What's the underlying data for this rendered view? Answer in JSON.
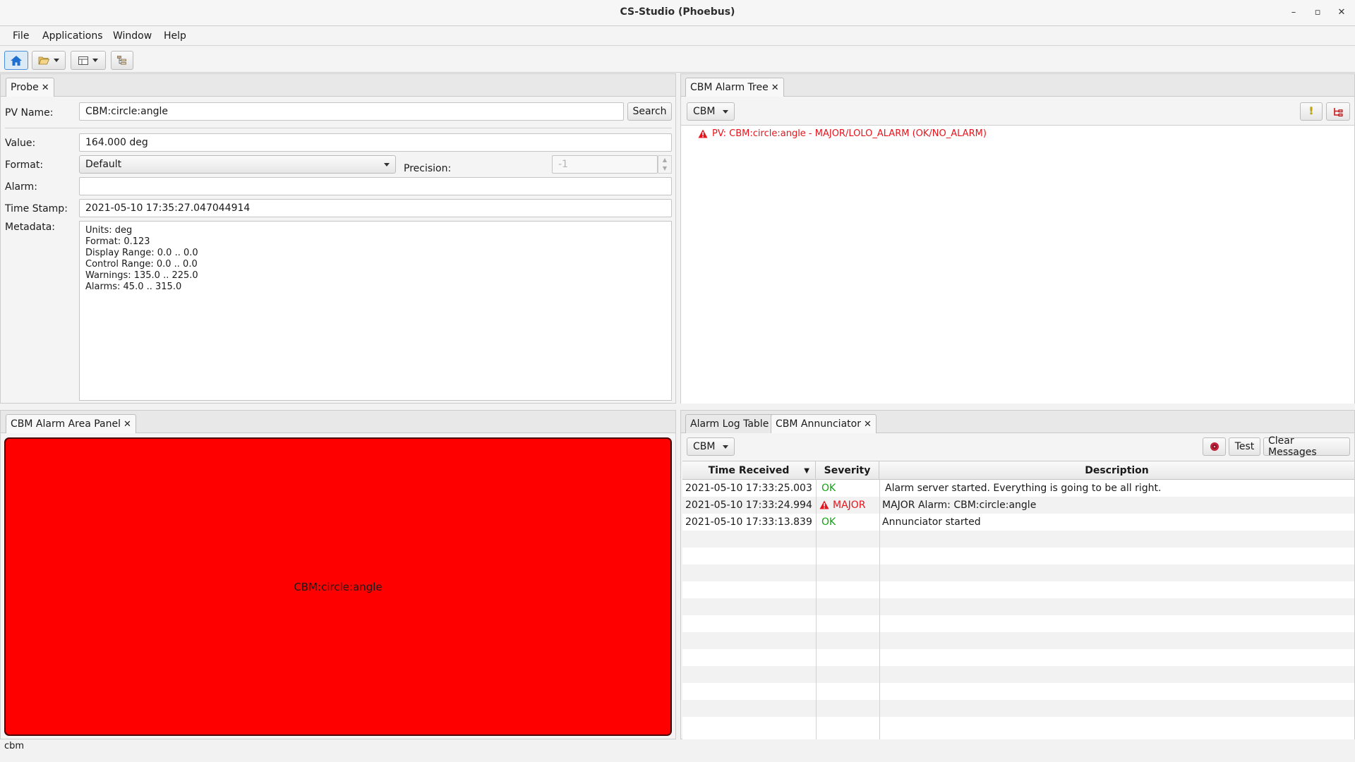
{
  "window": {
    "title": "CS-Studio (Phoebus)",
    "minimize": "–",
    "maximize": "▫",
    "close": "✕"
  },
  "menu": [
    "File",
    "Applications",
    "Window",
    "Help"
  ],
  "probe": {
    "tab_label": "Probe",
    "pv_name_label": "PV Name:",
    "pv_name_value": "CBM:circle:angle",
    "search_label": "Search",
    "value_label": "Value:",
    "value": "164.000 deg",
    "format_label": "Format:",
    "format_value": "Default",
    "precision_label": "Precision:",
    "precision_value": "-1",
    "alarm_label": "Alarm:",
    "alarm_value": "",
    "timestamp_label": "Time Stamp:",
    "timestamp_value": "2021-05-10 17:35:27.047044914",
    "metadata_label": "Metadata:",
    "metadata_lines": [
      "Units: deg",
      "Format: 0.123",
      "Display Range: 0.0 .. 0.0",
      "Control Range: 0.0 .. 0.0",
      "Warnings: 135.0 .. 225.0",
      "Alarms: 45.0 .. 315.0"
    ]
  },
  "alarm_tree": {
    "tab_label": "CBM Alarm Tree",
    "config": "CBM",
    "items": [
      {
        "text": "PV: CBM:circle:angle - MAJOR/LOLO_ALARM (OK/NO_ALARM)",
        "color": "#e8141b"
      }
    ]
  },
  "area_panel": {
    "tab_label": "CBM Alarm Area Panel",
    "area_label": "CBM:circle:angle",
    "area_color": "#ff0000"
  },
  "annunciator": {
    "tabs": [
      "Alarm Log Table",
      "CBM Annunciator"
    ],
    "config": "CBM",
    "test_label": "Test",
    "clear_label": "Clear Messages",
    "columns": [
      "Time Received",
      "Severity",
      "Description"
    ],
    "rows": [
      {
        "time": "2021-05-10 17:33:25.003",
        "severity": "OK",
        "severity_color": "#13a213",
        "description": "Alarm server started. Everything is going to be all right."
      },
      {
        "time": "2021-05-10 17:33:24.994",
        "severity": "MAJOR",
        "severity_color": "#e8141b",
        "description": "MAJOR Alarm: CBM:circle:angle"
      },
      {
        "time": "2021-05-10 17:33:13.839",
        "severity": "OK",
        "severity_color": "#13a213",
        "description": "Annunciator started"
      }
    ]
  },
  "status": {
    "text": "cbm"
  }
}
